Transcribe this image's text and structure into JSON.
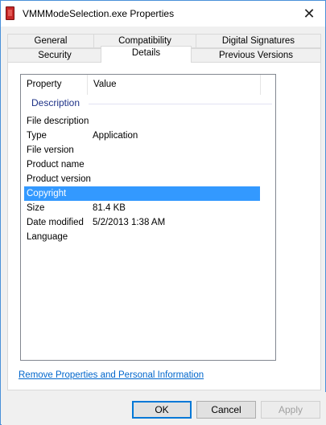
{
  "window": {
    "title": "VMMModeSelection.exe Properties",
    "close_glyph": "✕"
  },
  "tabs": [
    {
      "label": "General"
    },
    {
      "label": "Compatibility"
    },
    {
      "label": "Digital Signatures"
    },
    {
      "label": "Security"
    },
    {
      "label": "Details"
    },
    {
      "label": "Previous Versions"
    }
  ],
  "listview": {
    "columns": [
      "Property",
      "Value"
    ],
    "group": "Description",
    "rows": [
      {
        "key": "File description",
        "value": ""
      },
      {
        "key": "Type",
        "value": "Application"
      },
      {
        "key": "File version",
        "value": ""
      },
      {
        "key": "Product name",
        "value": ""
      },
      {
        "key": "Product version",
        "value": ""
      },
      {
        "key": "Copyright",
        "value": ""
      },
      {
        "key": "Size",
        "value": "81.4 KB"
      },
      {
        "key": "Date modified",
        "value": "5/2/2013 1:38 AM"
      },
      {
        "key": "Language",
        "value": ""
      }
    ],
    "selected_row": "Copyright"
  },
  "remove_link": "Remove Properties and Personal Information",
  "buttons": {
    "ok": "OK",
    "cancel": "Cancel",
    "apply": "Apply"
  },
  "colors": {
    "selection": "#3399ff",
    "link": "#0066cc",
    "group_header": "#1e3287"
  },
  "icons": {
    "app": "application-file-icon",
    "close": "close-icon"
  }
}
